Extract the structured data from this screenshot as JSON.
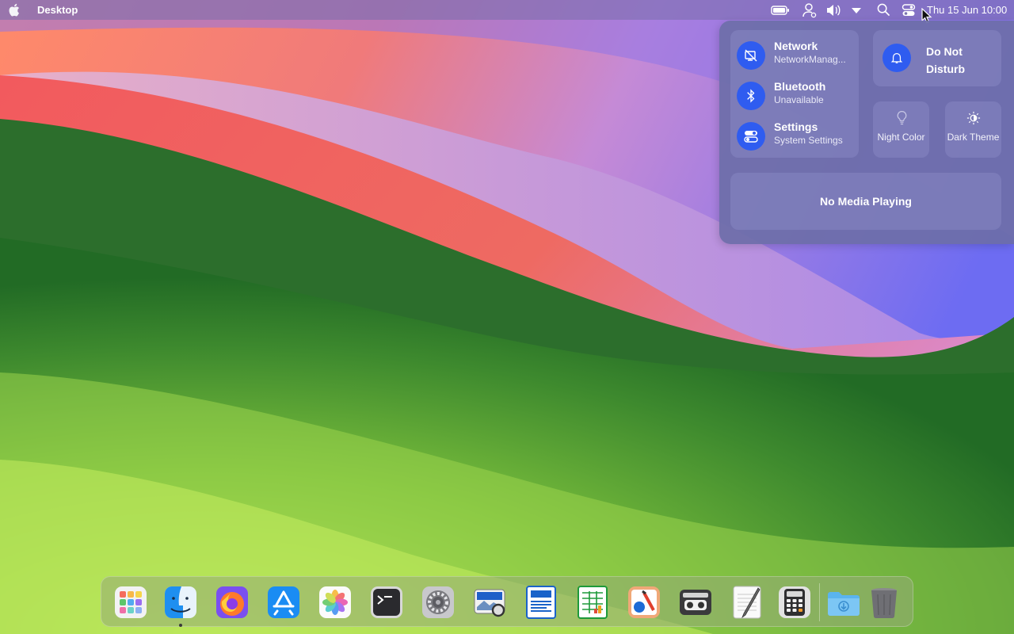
{
  "topbar": {
    "app_name": "Desktop",
    "clock": "Thu 15 Jun 10:00",
    "icons": [
      "apple-icon",
      "battery-icon",
      "user-icon",
      "volume-icon",
      "chevron-down-icon",
      "search-icon",
      "control-center-icon"
    ]
  },
  "panel": {
    "network": {
      "title": "Network",
      "subtitle": "NetworkManag..."
    },
    "bluetooth": {
      "title": "Bluetooth",
      "subtitle": "Unavailable"
    },
    "settings": {
      "title": "Settings",
      "subtitle": "System Settings"
    },
    "dnd": {
      "label": "Do Not Disturb"
    },
    "night_color": {
      "label": "Night Color"
    },
    "dark_theme": {
      "label": "Dark Theme"
    },
    "media": {
      "label": "No Media Playing"
    }
  },
  "dock": {
    "items": [
      "launchpad",
      "finder",
      "firefox",
      "app-store",
      "photos",
      "terminal",
      "system-settings",
      "image-viewer",
      "writer",
      "calc",
      "draw",
      "tape-recorder",
      "text-editor",
      "calculator",
      "downloads-folder",
      "trash"
    ]
  },
  "colors": {
    "accent": "#2f5cf0",
    "panel": "#6c6ea8",
    "topbar": "#786eaa"
  }
}
